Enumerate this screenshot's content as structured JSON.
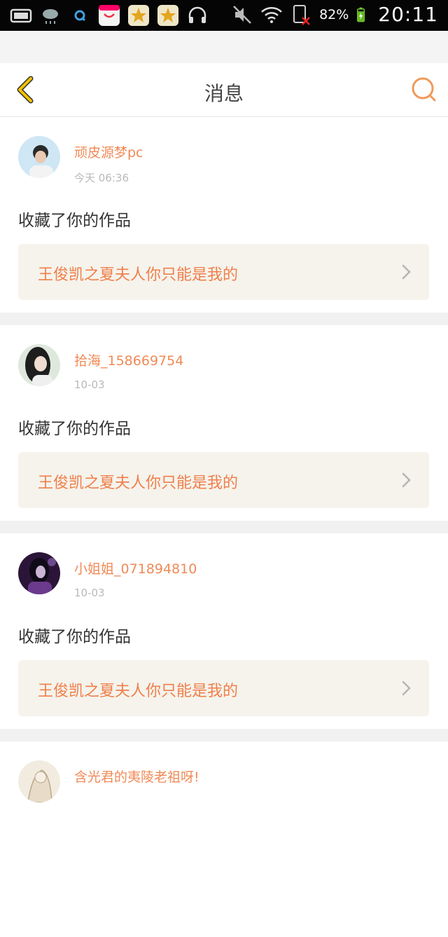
{
  "status_bar": {
    "icons_left": [
      "screen-icon",
      "cloud-rain-icon",
      "browser-icon",
      "gift-icon",
      "star-badge-icon",
      "star-badge-icon",
      "headphones-icon"
    ],
    "icons_right": [
      "mute-icon",
      "wifi-icon",
      "sim-icon",
      "battery-icon"
    ],
    "battery_percent": "82%",
    "time": "20:11"
  },
  "navbar": {
    "title": "消息",
    "back_icon": "chevron-left-icon",
    "search_icon": "search-icon"
  },
  "colors": {
    "accent": "#f08a57",
    "back_arrow": "#f2c200",
    "card_bg": "#ffffff",
    "work_box_bg": "#f5f3ec"
  },
  "messages": [
    {
      "username": "顽皮源梦pc",
      "time": "今天 06:36",
      "action": "收藏了你的作品",
      "work_title": "王俊凯之夏夫人你只能是我的"
    },
    {
      "username": "拾海_158669754",
      "time": "10-03",
      "action": "收藏了你的作品",
      "work_title": "王俊凯之夏夫人你只能是我的"
    },
    {
      "username": "小姐姐_071894810",
      "time": "10-03",
      "action": "收藏了你的作品",
      "work_title": "王俊凯之夏夫人你只能是我的"
    },
    {
      "username": "含光君的夷陵老祖呀!",
      "time": "",
      "action": "",
      "work_title": ""
    }
  ]
}
